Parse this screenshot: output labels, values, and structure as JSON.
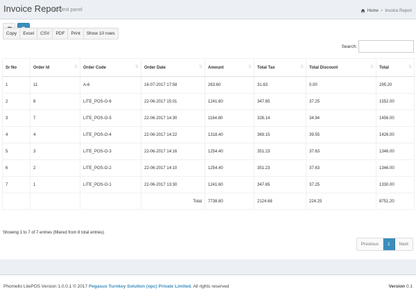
{
  "header": {
    "title": "Invoice Report",
    "subtitle": "Control panel",
    "breadcrumb_home": "Home",
    "breadcrumb_sep": ">",
    "breadcrumb_current": "Invoice Report"
  },
  "toolbar": {
    "buttons": [
      "Copy",
      "Excel",
      "CSV",
      "PDF",
      "Print",
      "Show 10 rows"
    ]
  },
  "search": {
    "label": "Search:",
    "value": ""
  },
  "table": {
    "columns": [
      "Sr No",
      "Order Id",
      "Order Code",
      "Order Date",
      "Amount",
      "Total Tax",
      "Total Discount",
      "Total"
    ],
    "rows": [
      [
        "1",
        "11",
        "A-6",
        "16-07-2017 17:58",
        "263.60",
        "31.63",
        "0.00",
        "295.20"
      ],
      [
        "2",
        "8",
        "LITE_POS-O-6",
        "22-06-2017 15:01",
        "1241.60",
        "347.65",
        "37.25",
        "1552.00"
      ],
      [
        "3",
        "7",
        "LITE_POS-O-5",
        "22-06-2017 14:30",
        "1164.80",
        "326.14",
        "34.94",
        "1456.00"
      ],
      [
        "4",
        "4",
        "LITE_POS-O-4",
        "22-06-2017 14:22",
        "1318.40",
        "369.15",
        "39.55",
        "1426.00"
      ],
      [
        "5",
        "3",
        "LITE_POS-O-3",
        "22-06-2017 14:16",
        "1254.40",
        "351.23",
        "37.63",
        "1346.00"
      ],
      [
        "6",
        "2",
        "LITE_POS-O-2",
        "22-06-2017 14:10",
        "1254.40",
        "351.23",
        "37.63",
        "1346.00"
      ],
      [
        "7",
        "1",
        "LITE_POS-O-1",
        "22-06-2017 13:30",
        "1241.60",
        "347.65",
        "37.25",
        "1330.00"
      ]
    ],
    "totals": {
      "label": "Total",
      "amount": "7738.80",
      "tax": "2124.68",
      "discount": "224.25",
      "total": "8751.20"
    }
  },
  "info": "Showing 1 to 7 of 7 entries (filtered from 8 total entries)",
  "pagination": {
    "previous": "Previous",
    "current": "1",
    "next": "Next"
  },
  "footer": {
    "prefix": "Phomello LitePOS Version 1.0.0.1 © 2017",
    "company": "Pegasus Turnkey Solution (opc) Private Limited.",
    "suffix": "All rights reserved",
    "version_label": "Version",
    "version_value": "0.1"
  },
  "colors": {
    "primary": "#3c8dbc",
    "background": "#ecf0f5"
  }
}
